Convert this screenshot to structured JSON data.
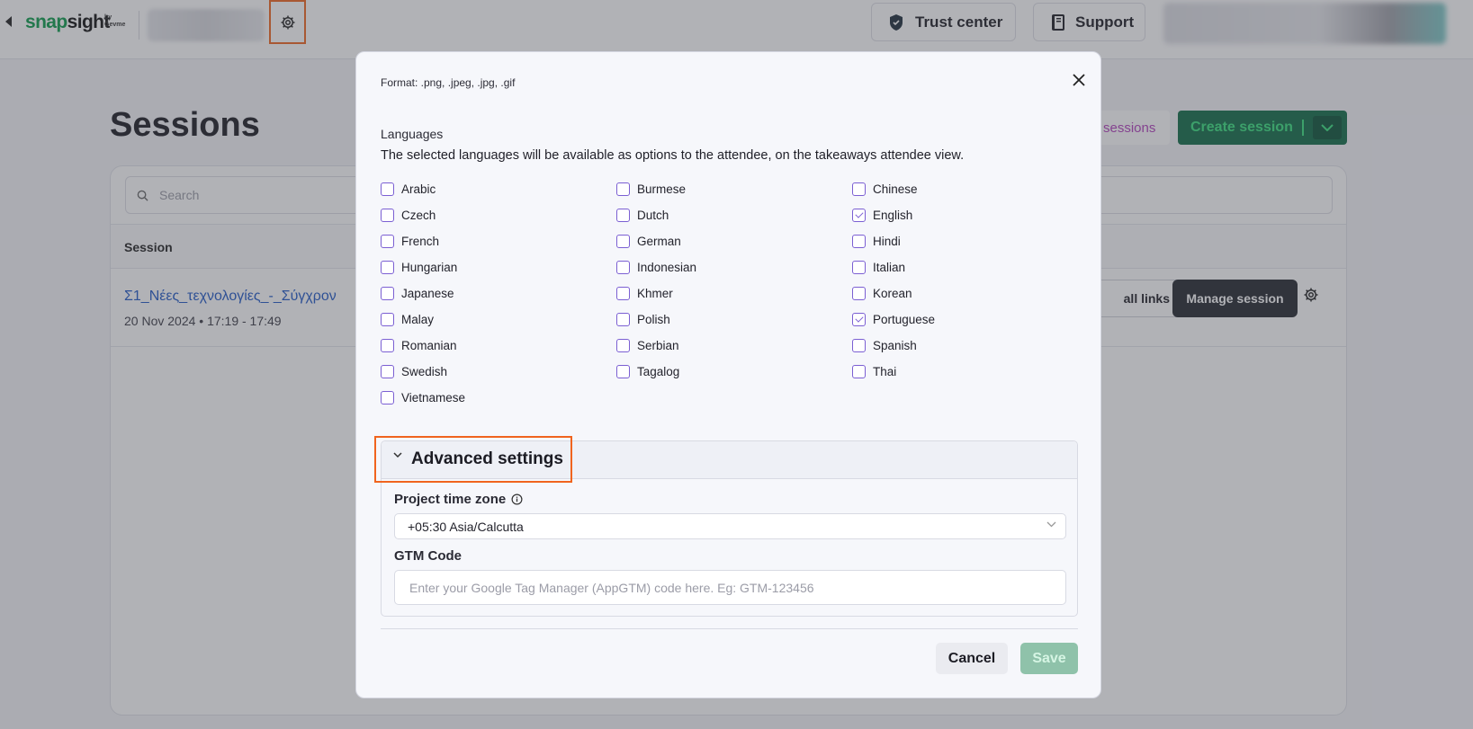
{
  "topbar": {
    "logo_snap": "snap",
    "logo_sight": "sight",
    "logo_by": "by",
    "logo_brand": "Gevme",
    "trust_center_label": "Trust center",
    "support_label": "Support"
  },
  "page": {
    "title": "Sessions",
    "sessions_link": "sessions",
    "create_session_label": "Create session",
    "search_placeholder": "Search",
    "column_session": "Session",
    "session_row": {
      "name": "Σ1_Νέες_τεχνολογίες_-_Σύγχρον",
      "date": "20 Nov 2024 • 17:19 - 17:49",
      "all_links_label": "all links",
      "manage_label": "Manage session"
    }
  },
  "modal": {
    "format_text": "Format: .png, .jpeg, .jpg, .gif",
    "languages_label": "Languages",
    "languages_desc": "The selected languages will be available as options to the attendee, on the takeaways attendee view.",
    "languages": [
      {
        "label": "Arabic",
        "checked": false
      },
      {
        "label": "Burmese",
        "checked": false
      },
      {
        "label": "Chinese",
        "checked": false
      },
      {
        "label": "Czech",
        "checked": false
      },
      {
        "label": "Dutch",
        "checked": false
      },
      {
        "label": "English",
        "checked": true
      },
      {
        "label": "French",
        "checked": false
      },
      {
        "label": "German",
        "checked": false
      },
      {
        "label": "Hindi",
        "checked": false
      },
      {
        "label": "Hungarian",
        "checked": false
      },
      {
        "label": "Indonesian",
        "checked": false
      },
      {
        "label": "Italian",
        "checked": false
      },
      {
        "label": "Japanese",
        "checked": false
      },
      {
        "label": "Khmer",
        "checked": false
      },
      {
        "label": "Korean",
        "checked": false
      },
      {
        "label": "Malay",
        "checked": false
      },
      {
        "label": "Polish",
        "checked": false
      },
      {
        "label": "Portuguese",
        "checked": true
      },
      {
        "label": "Romanian",
        "checked": false
      },
      {
        "label": "Serbian",
        "checked": false
      },
      {
        "label": "Spanish",
        "checked": false
      },
      {
        "label": "Swedish",
        "checked": false
      },
      {
        "label": "Tagalog",
        "checked": false
      },
      {
        "label": "Thai",
        "checked": false
      },
      {
        "label": "Vietnamese",
        "checked": false
      }
    ],
    "advanced_title": "Advanced settings",
    "timezone_label": "Project time zone",
    "timezone_value": "+05:30 Asia/Calcutta",
    "gtm_label": "GTM Code",
    "gtm_placeholder": "Enter your Google Tag Manager (AppGTM) code here. Eg: GTM-123456",
    "gtm_value": "",
    "cancel_label": "Cancel",
    "save_label": "Save"
  },
  "colors": {
    "brand_green": "#0c9b4a",
    "checkbox_purple": "#7b5fd3",
    "highlight_orange": "#f0641e",
    "save_disabled": "#8fc2aa"
  }
}
